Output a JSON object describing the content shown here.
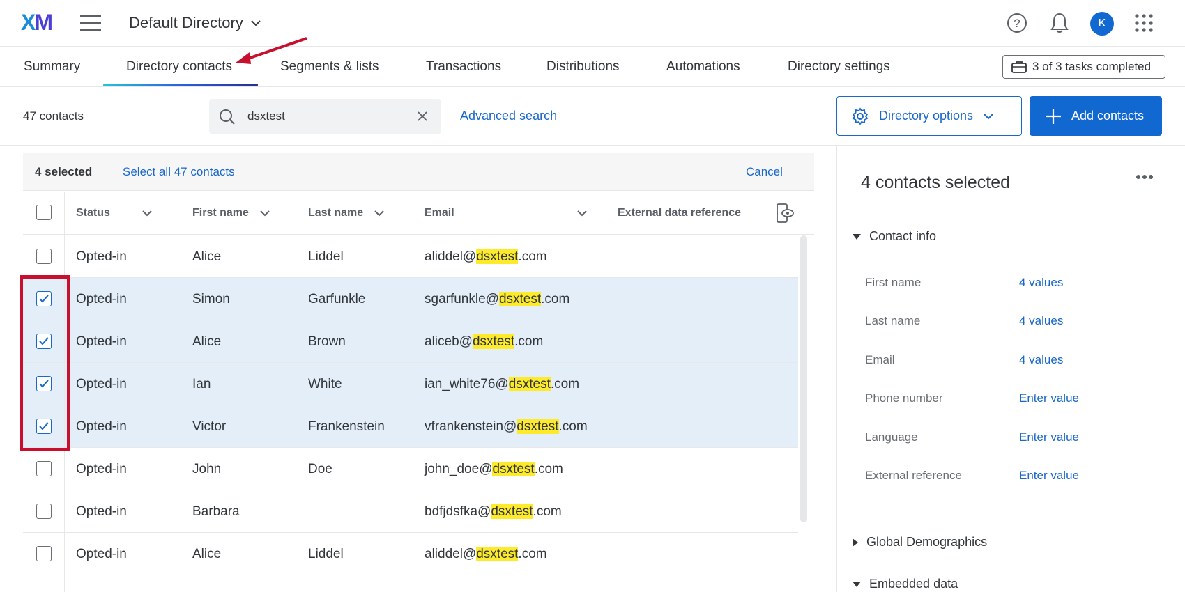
{
  "header": {
    "logo": {
      "x": "X",
      "m": "M"
    },
    "directory_title": "Default Directory"
  },
  "tabs": [
    {
      "label": "Summary"
    },
    {
      "label": "Directory contacts"
    },
    {
      "label": "Segments & lists"
    },
    {
      "label": "Transactions"
    },
    {
      "label": "Distributions"
    },
    {
      "label": "Automations"
    },
    {
      "label": "Directory settings"
    }
  ],
  "tasks_label": "3 of 3 tasks completed",
  "toolbar": {
    "contact_count": "47 contacts",
    "search_value": "dsxtest",
    "advanced_search": "Advanced search",
    "directory_options": "Directory options",
    "add_contacts": "Add contacts"
  },
  "selection": {
    "selected": "4 selected",
    "select_all": "Select all 47 contacts",
    "cancel": "Cancel"
  },
  "table": {
    "headers": [
      "Status",
      "First name",
      "Last name",
      "Email",
      "External data reference"
    ],
    "rows": [
      {
        "status": "Opted-in",
        "first": "Alice",
        "last": "Liddel",
        "email_pre": "aliddel@",
        "email_hl": "dsxtest",
        "email_post": ".com",
        "checked": false
      },
      {
        "status": "Opted-in",
        "first": "Simon",
        "last": "Garfunkle",
        "email_pre": "sgarfunkle@",
        "email_hl": "dsxtest",
        "email_post": ".com",
        "checked": true
      },
      {
        "status": "Opted-in",
        "first": "Alice",
        "last": "Brown",
        "email_pre": "aliceb@",
        "email_hl": "dsxtest",
        "email_post": ".com",
        "checked": true
      },
      {
        "status": "Opted-in",
        "first": "Ian",
        "last": "White",
        "email_pre": "ian_white76@",
        "email_hl": "dsxtest",
        "email_post": ".com",
        "checked": true
      },
      {
        "status": "Opted-in",
        "first": "Victor",
        "last": "Frankenstein",
        "email_pre": "vfrankenstein@",
        "email_hl": "dsxtest",
        "email_post": ".com",
        "checked": true
      },
      {
        "status": "Opted-in",
        "first": "John",
        "last": "Doe",
        "email_pre": "john_doe@",
        "email_hl": "dsxtest",
        "email_post": ".com",
        "checked": false
      },
      {
        "status": "Opted-in",
        "first": "Barbara",
        "last": "",
        "email_pre": "bdfjdsfka@",
        "email_hl": "dsxtest",
        "email_post": ".com",
        "checked": false
      },
      {
        "status": "Opted-in",
        "first": "Alice",
        "last": "Liddel",
        "email_pre": "aliddel@",
        "email_hl": "dsxtest",
        "email_post": ".com",
        "checked": false
      }
    ]
  },
  "panel": {
    "title": "4 contacts selected",
    "contact_info": "Contact info",
    "fields": [
      {
        "label": "First name",
        "value": "4 values"
      },
      {
        "label": "Last name",
        "value": "4 values"
      },
      {
        "label": "Email",
        "value": "4 values"
      },
      {
        "label": "Phone number",
        "value": "Enter value"
      },
      {
        "label": "Language",
        "value": "Enter value"
      },
      {
        "label": "External reference",
        "value": "Enter value"
      }
    ],
    "global_demographics": "Global Demographics",
    "embedded_data": "Embedded data"
  },
  "user_initial": "K",
  "colors": {
    "accent": "#1a68c8",
    "selected_row": "#e3eef9",
    "highlight": "#fcea2b",
    "annotation": "#c8102e"
  }
}
